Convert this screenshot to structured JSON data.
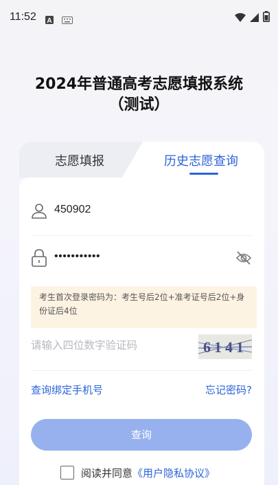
{
  "status_bar": {
    "time": "11:52",
    "icons_left": [
      "a-notification-icon",
      "keyboard-icon"
    ],
    "icons_right": [
      "wifi-icon",
      "signal-icon",
      "battery-icon"
    ]
  },
  "page": {
    "title": "2024年普通高考志愿填报系统（测试）"
  },
  "tabs": [
    {
      "label": "志愿填报",
      "active": false
    },
    {
      "label": "历史志愿查询",
      "active": true
    }
  ],
  "form": {
    "username_value": "450902",
    "password_value": "•••••••••••",
    "notice": "考生首次登录密码为：考生号后2位+准考证号后2位+身份证后4位",
    "captcha_placeholder": "请输入四位数字验证码",
    "captcha_image_text": "6141"
  },
  "links": {
    "bind_phone": "查询绑定手机号",
    "forgot_password": "忘记密码?"
  },
  "submit": {
    "label": "查询"
  },
  "agreement": {
    "prefix": "阅读并同意",
    "link": "《用户隐私协议》",
    "checked": false
  },
  "colors": {
    "accent": "#2b63d9",
    "button_disabled": "#97b1ee",
    "notice_bg": "#fdf3e3"
  }
}
